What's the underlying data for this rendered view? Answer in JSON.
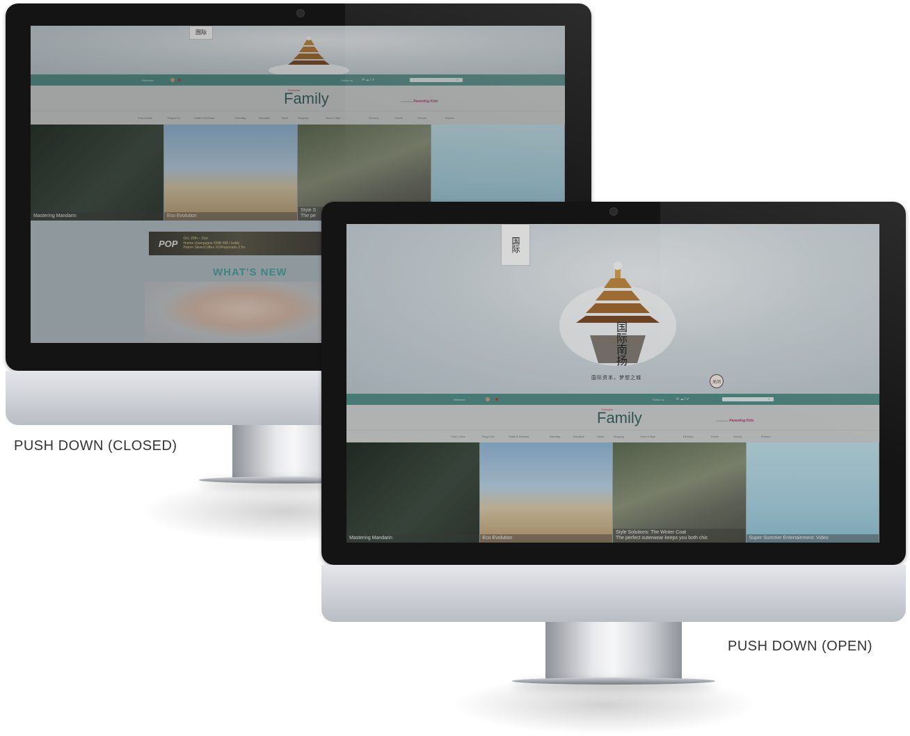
{
  "labels": {
    "closed": "PUSH DOWN (CLOSED)",
    "open": "PUSH DOWN (OPEN)"
  },
  "site": {
    "logo_small": "Shanghai",
    "logo": "Family",
    "presented_by": "presented by",
    "presenter": "Parenting Kids",
    "topbar_left": "Welcome",
    "topbar_right": "Follow us",
    "nav": [
      "Food & Drink",
      "Thing to Do",
      "Health & Wellness",
      "Parenting",
      "Education",
      "Travel",
      "Shopping",
      "Home & Style",
      "Directory",
      "Events",
      "Schools",
      "Pictures"
    ],
    "tiles": [
      {
        "caption": "Mastering Mandarin"
      },
      {
        "caption": "Eco Evolution"
      },
      {
        "caption": "Style Solutions: The Winter Coat",
        "sub": "The perfect outerwear keeps you both chic"
      },
      {
        "caption": "Super Summer Entertainment: Video"
      }
    ],
    "closed_tile3_caption": "Style S",
    "closed_tile3_sub": "The pe",
    "banner": {
      "brand": "POP",
      "line1": "Oct. 29th – 31st",
      "line2": "Humm champagne RMB 588 / bottle",
      "line3": "Patron Silver/Coffee XO/Reposado 2 for"
    },
    "whats_new": "WHAT'S NEW",
    "hero_seal": "国际",
    "hero_title": "国际南扬",
    "hero_tagline": "国际资本，梦想之城",
    "close_label": "关闭"
  },
  "colors": {
    "topbar": "#4f8d87",
    "accent": "#4aa8a6",
    "logo": "#2f5f5a"
  }
}
